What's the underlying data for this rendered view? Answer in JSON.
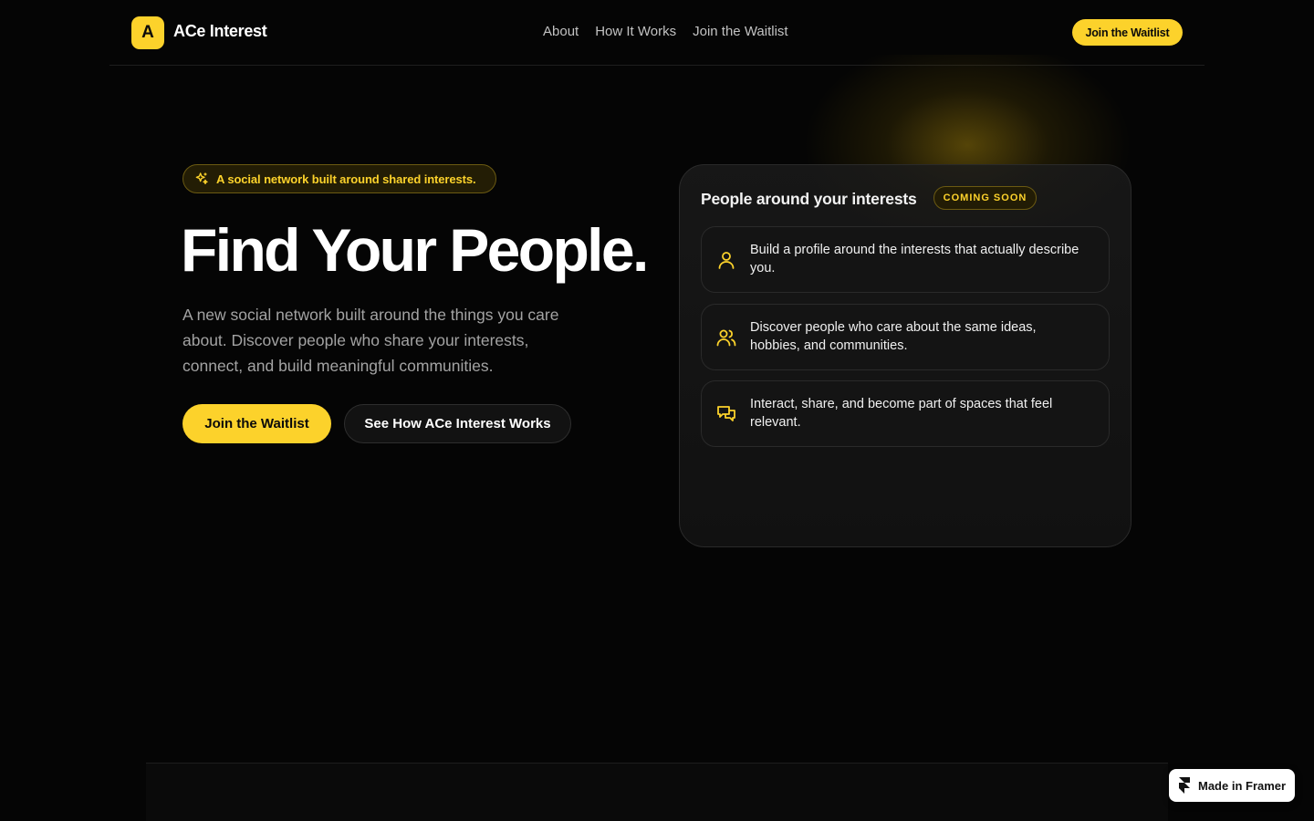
{
  "header": {
    "logo_letter": "A",
    "brand": "ACe Interest",
    "nav": [
      {
        "label": "About"
      },
      {
        "label": "How It Works"
      },
      {
        "label": "Join the Waitlist"
      }
    ],
    "cta_label": "Join the Waitlist"
  },
  "hero": {
    "badge_icon": "sparkles-icon",
    "badge": "A social network built around shared interests.",
    "title": "Find Your People.",
    "subtitle": "A new social network built around the things you care about. Discover people who share your interests, connect, and build meaningful communities.",
    "primary_cta": "Join the Waitlist",
    "secondary_cta": "See How ACe Interest Works"
  },
  "card": {
    "title": "People around your interests",
    "badge": "COMING SOON",
    "features": [
      {
        "icon": "user-icon",
        "text": "Build a profile around the interests that actually describe you."
      },
      {
        "icon": "users-icon",
        "text": "Discover people who care about the same ideas, hobbies, and communities."
      },
      {
        "icon": "chat-bubbles-icon",
        "text": "Interact, share, and become part of spaces that feel relevant."
      }
    ]
  },
  "framer_badge": {
    "icon": "framer-logo-icon",
    "label": "Made in Framer"
  },
  "colors": {
    "accent": "#fcd22b",
    "background": "#050505",
    "muted_text": "#a3a3a3"
  }
}
